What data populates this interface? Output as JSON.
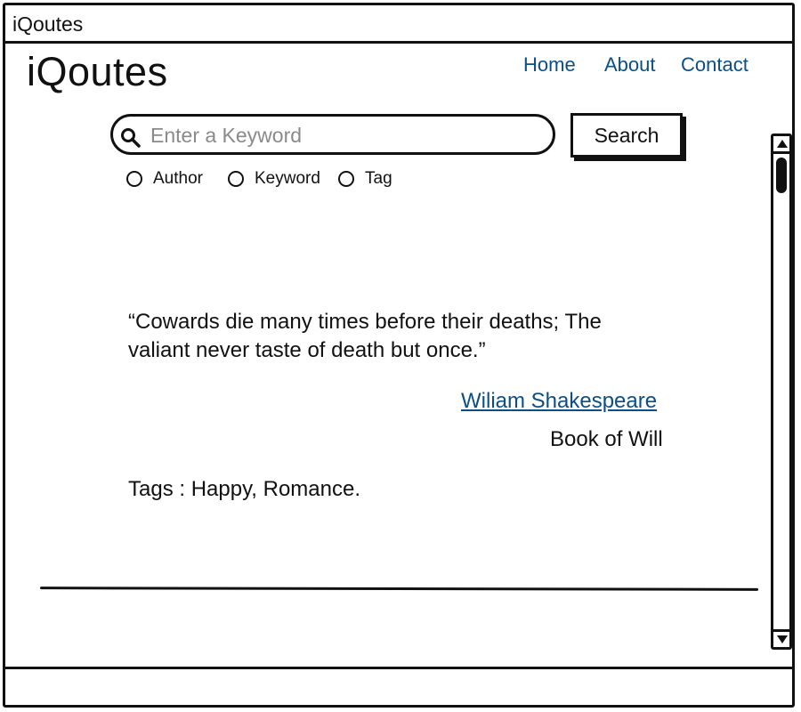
{
  "window": {
    "title": "iQoutes"
  },
  "header": {
    "logo": "iQoutes",
    "nav": [
      {
        "label": "Home"
      },
      {
        "label": "About"
      },
      {
        "label": "Contact"
      }
    ]
  },
  "search": {
    "placeholder": "Enter a Keyword",
    "value": "",
    "button_label": "Search",
    "filters": [
      {
        "label": "Author",
        "checked": false
      },
      {
        "label": "Keyword",
        "checked": false
      },
      {
        "label": "Tag",
        "checked": false
      }
    ]
  },
  "quote": {
    "text": "“Cowards die many times before their deaths; The valiant never taste of death but once.”",
    "author": "Wiliam Shakespeare",
    "book": "Book of Will",
    "tags": "Tags : Happy, Romance."
  },
  "colors": {
    "link": "#0b4f86",
    "border": "#111111",
    "placeholder": "#8a8a8a"
  },
  "icons": {
    "search": "search-icon"
  }
}
